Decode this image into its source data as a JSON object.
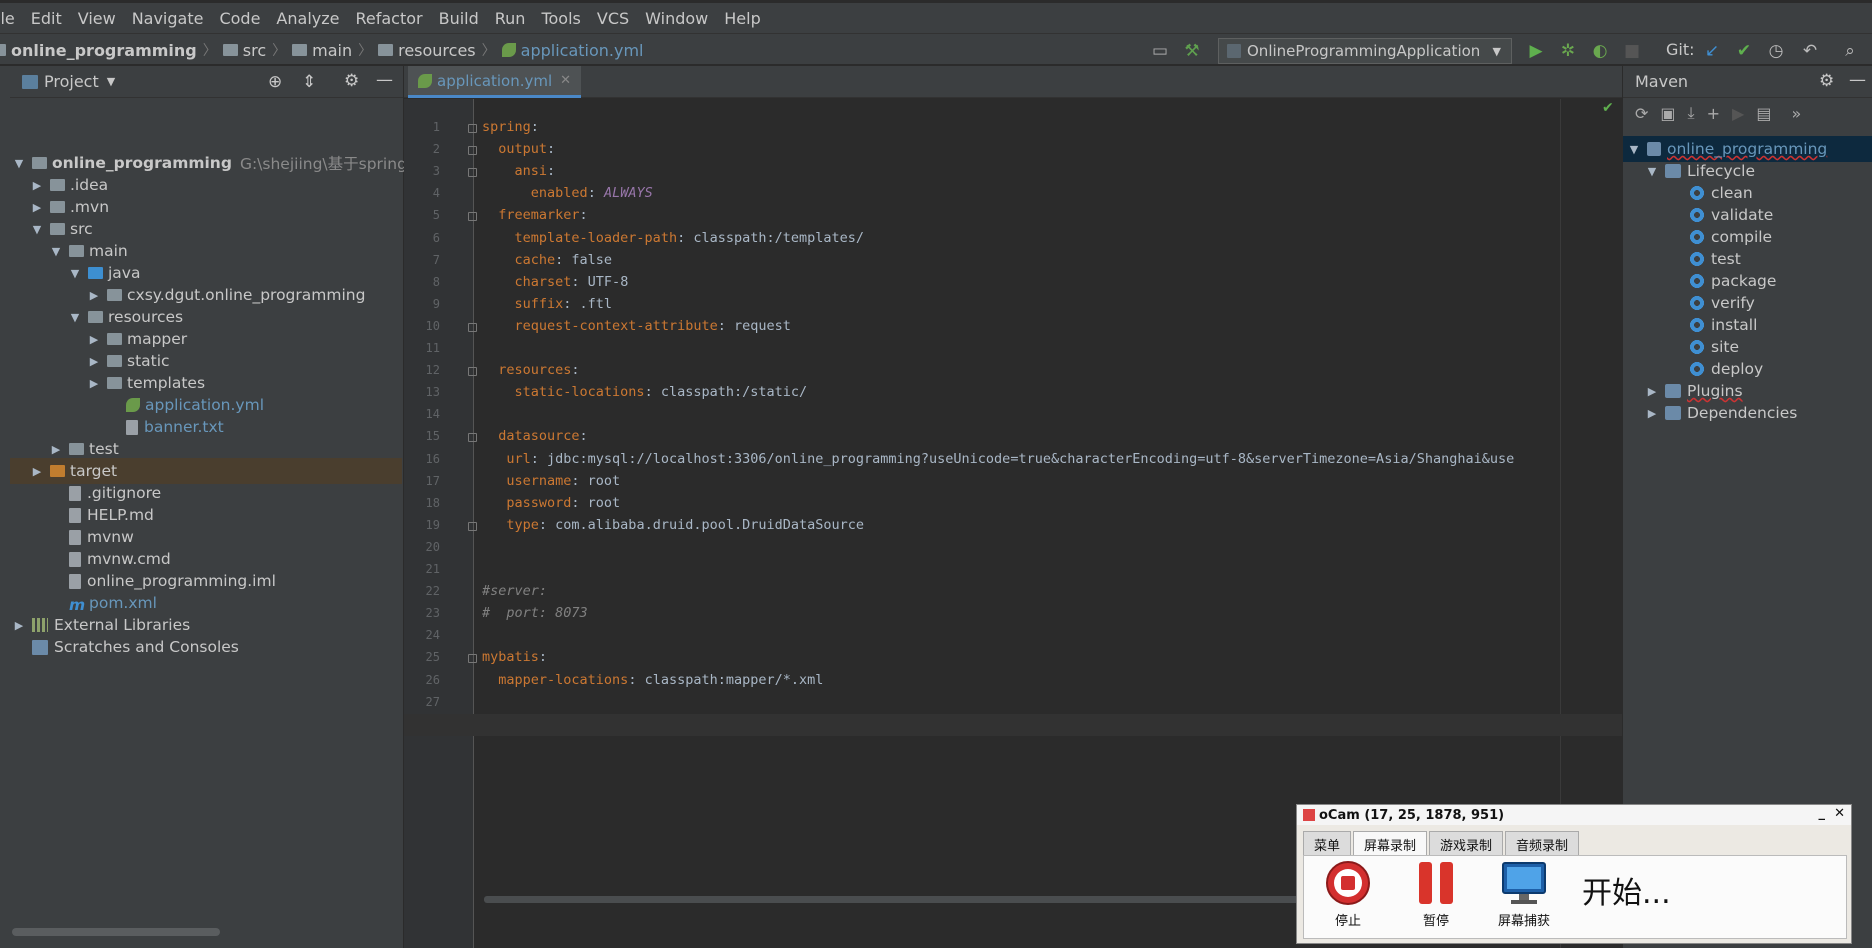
{
  "menu": [
    "ile",
    "Edit",
    "View",
    "Navigate",
    "Code",
    "Analyze",
    "Refactor",
    "Build",
    "Run",
    "Tools",
    "VCS",
    "Window",
    "Help"
  ],
  "breadcrumb": {
    "project": "online_programming",
    "items": [
      "src",
      "main",
      "resources",
      "application.yml"
    ]
  },
  "toolbar": {
    "run_config": "OnlineProgrammingApplication",
    "git_label": "Git:"
  },
  "project_panel": {
    "title": "Project",
    "root": "online_programming",
    "root_path": "G:\\shejiing\\基于springBo",
    "tree": [
      {
        "label": "online_programming",
        "depth": 0,
        "expanded": true,
        "icon": "module"
      },
      {
        "label": ".idea",
        "depth": 1,
        "expanded": false,
        "icon": "folder"
      },
      {
        "label": ".mvn",
        "depth": 1,
        "expanded": false,
        "icon": "folder"
      },
      {
        "label": "src",
        "depth": 1,
        "expanded": true,
        "icon": "folder"
      },
      {
        "label": "main",
        "depth": 2,
        "expanded": true,
        "icon": "folder"
      },
      {
        "label": "java",
        "depth": 3,
        "expanded": true,
        "icon": "folder-blue"
      },
      {
        "label": "cxsy.dgut.online_programming",
        "depth": 4,
        "expanded": false,
        "icon": "package"
      },
      {
        "label": "resources",
        "depth": 3,
        "expanded": true,
        "icon": "folder-res"
      },
      {
        "label": "mapper",
        "depth": 4,
        "expanded": false,
        "icon": "folder"
      },
      {
        "label": "static",
        "depth": 4,
        "expanded": false,
        "icon": "folder"
      },
      {
        "label": "templates",
        "depth": 4,
        "expanded": false,
        "icon": "folder"
      },
      {
        "label": "application.yml",
        "depth": 5,
        "icon": "yml"
      },
      {
        "label": "banner.txt",
        "depth": 5,
        "icon": "txt"
      },
      {
        "label": "test",
        "depth": 2,
        "expanded": false,
        "icon": "folder"
      },
      {
        "label": "target",
        "depth": 1,
        "expanded": false,
        "icon": "folder-orange"
      },
      {
        "label": ".gitignore",
        "depth": 2,
        "icon": "file"
      },
      {
        "label": "HELP.md",
        "depth": 2,
        "icon": "md"
      },
      {
        "label": "mvnw",
        "depth": 2,
        "icon": "file"
      },
      {
        "label": "mvnw.cmd",
        "depth": 2,
        "icon": "file"
      },
      {
        "label": "online_programming.iml",
        "depth": 2,
        "icon": "file"
      },
      {
        "label": "pom.xml",
        "depth": 2,
        "icon": "maven"
      },
      {
        "label": "External Libraries",
        "depth": 0,
        "expanded": false,
        "icon": "lib"
      },
      {
        "label": "Scratches and Consoles",
        "depth": 0,
        "icon": "scratch"
      }
    ]
  },
  "editor": {
    "tab": "application.yml",
    "lines": [
      "spring:",
      "  output:",
      "    ansi:",
      "      enabled: ALWAYS",
      "  freemarker:",
      "    template-loader-path: classpath:/templates/",
      "    cache: false",
      "    charset: UTF-8",
      "    suffix: .ftl",
      "    request-context-attribute: request",
      "",
      "  resources:",
      "    static-locations: classpath:/static/",
      "",
      "  datasource:",
      "   url: jdbc:mysql://localhost:3306/online_programming?useUnicode=true&characterEncoding=utf-8&serverTimezone=Asia/Shanghai&use",
      "   username: root",
      "   password: root",
      "   type: com.alibaba.druid.pool.DruidDataSource",
      "",
      "",
      "#server:",
      "#  port: 8073",
      "",
      "mybatis:",
      "  mapper-locations: classpath:mapper/*.xml",
      "",
      ""
    ]
  },
  "maven_panel": {
    "title": "Maven",
    "root": "online_programming",
    "lifecycle_label": "Lifecycle",
    "goals": [
      "clean",
      "validate",
      "compile",
      "test",
      "package",
      "verify",
      "install",
      "site",
      "deploy"
    ],
    "plugins_label": "Plugins",
    "dependencies_label": "Dependencies"
  },
  "ocam": {
    "title": "oCam (17, 25, 1878, 951)",
    "tabs": [
      "菜单",
      "屏幕录制",
      "游戏录制",
      "音频录制"
    ],
    "active_tab": 1,
    "buttons": [
      "停止",
      "暂停",
      "屏幕捕获"
    ],
    "status": "开始..."
  }
}
